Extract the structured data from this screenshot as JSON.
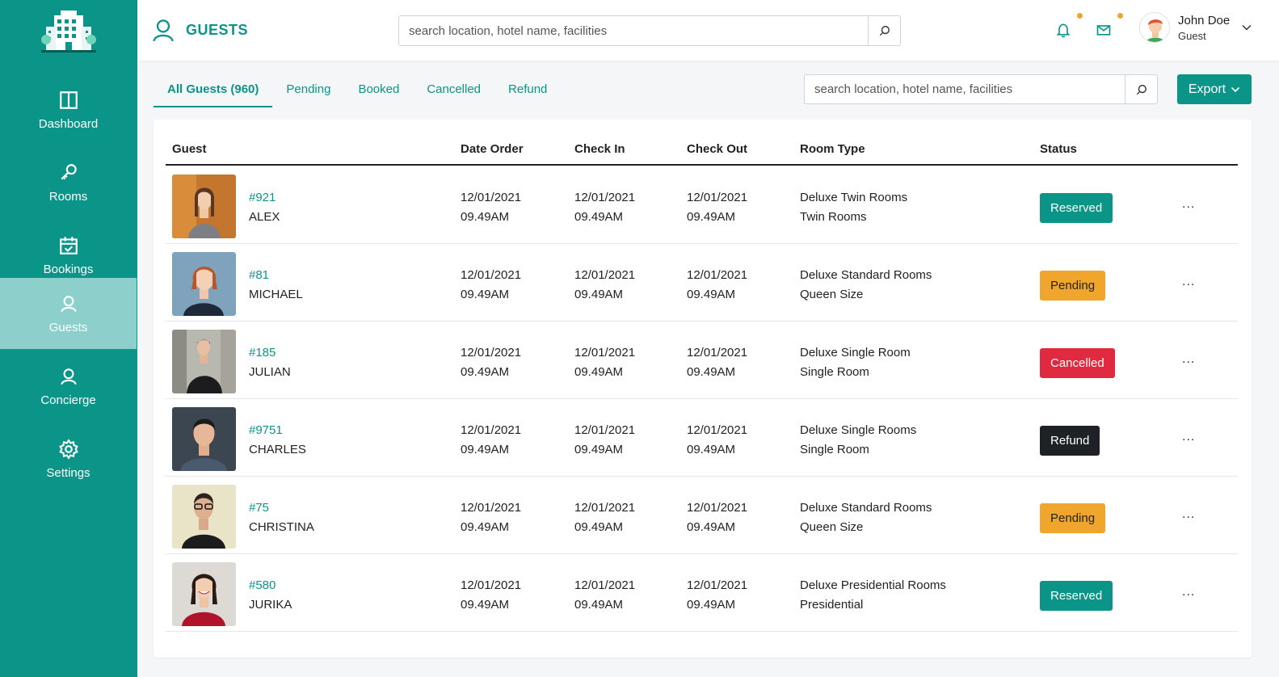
{
  "sidebar": {
    "items": [
      {
        "label": "Dashboard",
        "icon": "columns-icon"
      },
      {
        "label": "Rooms",
        "icon": "key-icon"
      },
      {
        "label": "Bookings",
        "icon": "calendar-check-icon"
      },
      {
        "label": "Guests",
        "icon": "user-icon",
        "active": true
      },
      {
        "label": "Concierge",
        "icon": "user-icon"
      },
      {
        "label": "Settings",
        "icon": "gear-icon"
      }
    ]
  },
  "header": {
    "title": "GUESTS",
    "search_placeholder": "search location, hotel name, facilities",
    "user": {
      "name": "John Doe",
      "role": "Guest"
    }
  },
  "tabs": [
    {
      "label": "All Guests (960)",
      "active": true
    },
    {
      "label": "Pending"
    },
    {
      "label": "Booked"
    },
    {
      "label": "Cancelled"
    },
    {
      "label": "Refund"
    }
  ],
  "toolbar": {
    "search_placeholder": "search location, hotel name, facilities",
    "export_label": "Export"
  },
  "table": {
    "headers": [
      "Guest",
      "Date Order",
      "Check In",
      "Check Out",
      "Room Type",
      "Status"
    ],
    "rows": [
      {
        "id": "#921",
        "name": "ALEX",
        "date_order": "12/01/2021",
        "date_order_time": "09.49AM",
        "check_in": "12/01/2021",
        "check_in_time": "09.49AM",
        "check_out": "12/01/2021",
        "check_out_time": "09.49AM",
        "room": "Deluxe Twin Rooms",
        "room_sub": "Twin Rooms",
        "status": "Reserved",
        "more": "..."
      },
      {
        "id": "#81",
        "name": "MICHAEL",
        "date_order": "12/01/2021",
        "date_order_time": "09.49AM",
        "check_in": "12/01/2021",
        "check_in_time": "09.49AM",
        "check_out": "12/01/2021",
        "check_out_time": "09.49AM",
        "room": "Deluxe Standard Rooms",
        "room_sub": "Queen Size",
        "status": "Pending",
        "more": "..."
      },
      {
        "id": "#185",
        "name": "JULIAN",
        "date_order": "12/01/2021",
        "date_order_time": "09.49AM",
        "check_in": "12/01/2021",
        "check_in_time": "09.49AM",
        "check_out": "12/01/2021",
        "check_out_time": "09.49AM",
        "room": "Deluxe Single Room",
        "room_sub": "Single Room",
        "status": "Cancelled",
        "more": "..."
      },
      {
        "id": "#9751",
        "name": "CHARLES",
        "date_order": "12/01/2021",
        "date_order_time": "09.49AM",
        "check_in": "12/01/2021",
        "check_in_time": "09.49AM",
        "check_out": "12/01/2021",
        "check_out_time": "09.49AM",
        "room": "Deluxe Single Rooms",
        "room_sub": "Single Room",
        "status": "Refund",
        "more": "..."
      },
      {
        "id": "#75",
        "name": "CHRISTINA",
        "date_order": "12/01/2021",
        "date_order_time": "09.49AM",
        "check_in": "12/01/2021",
        "check_in_time": "09.49AM",
        "check_out": "12/01/2021",
        "check_out_time": "09.49AM",
        "room": "Deluxe Standard Rooms",
        "room_sub": "Queen Size",
        "status": "Pending",
        "more": "..."
      },
      {
        "id": "#580",
        "name": "JURIKA",
        "date_order": "12/01/2021",
        "date_order_time": "09.49AM",
        "check_in": "12/01/2021",
        "check_in_time": "09.49AM",
        "check_out": "12/01/2021",
        "check_out_time": "09.49AM",
        "room": "Deluxe Presidential Rooms",
        "room_sub": "Presidential",
        "status": "Reserved",
        "more": "..."
      }
    ]
  },
  "colors": {
    "brand": "#0b9488",
    "sidebar_active": "#8ccfcb",
    "reserved": "#0b9488",
    "pending": "#f0a52d",
    "cancelled": "#e02a3f",
    "refund": "#1e2226",
    "notification_dot": "#f0a52d"
  }
}
